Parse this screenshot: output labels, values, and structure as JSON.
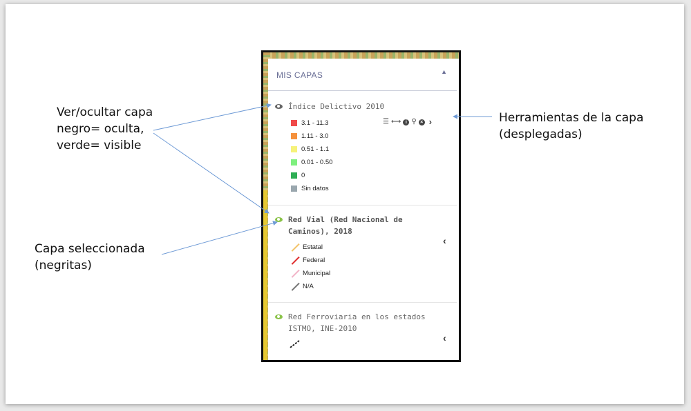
{
  "annotations": {
    "toggle_visibility": "Ver/ocultar capa\nnegro= oculta,\nverde= visible",
    "layer_tools": "Herramientas de la capa\n(desplegadas)",
    "selected_layer": "Capa seleccionada\n(negritas)"
  },
  "panel": {
    "title": "MIS CAPAS",
    "collapse_icon": "caret-up-icon"
  },
  "layers": [
    {
      "name": "Índice Delictivo 2010",
      "visible": false,
      "selected": false,
      "tools_expanded": true,
      "tools": [
        "table-icon",
        "resize-horizontal-icon",
        "info-icon",
        "search-icon",
        "remove-icon"
      ],
      "legend": [
        {
          "label": "3.1 - 11.3",
          "color": "#f04a4a"
        },
        {
          "label": "1.11 - 3.0",
          "color": "#f5913c"
        },
        {
          "label": "0.51 - 1.1",
          "color": "#f6f27a"
        },
        {
          "label": "0.01 - 0.50",
          "color": "#7ef07e"
        },
        {
          "label": "0",
          "color": "#2fae55"
        },
        {
          "label": "Sin datos",
          "color": "#9aa7ae"
        }
      ]
    },
    {
      "name": "Red Vial (Red Nacional de\nCaminos), 2018",
      "visible": true,
      "selected": true,
      "tools_expanded": false,
      "legend": [
        {
          "label": "Estatal",
          "color": "#f3c46a"
        },
        {
          "label": "Federal",
          "color": "#e03030"
        },
        {
          "label": "Municipal",
          "color": "#f2b4c8"
        },
        {
          "label": "N/A",
          "color": "#777777"
        }
      ]
    },
    {
      "name": "Red Ferroviaria en los estados\nISTMO, INE-2010",
      "visible": true,
      "selected": false,
      "tools_expanded": false,
      "legend_icon": "railway-line-icon"
    }
  ],
  "colors": {
    "eye_hidden": "#666666",
    "eye_visible": "#8bc34a",
    "arrow": "#6f9bd6",
    "title": "#6a6f96"
  }
}
